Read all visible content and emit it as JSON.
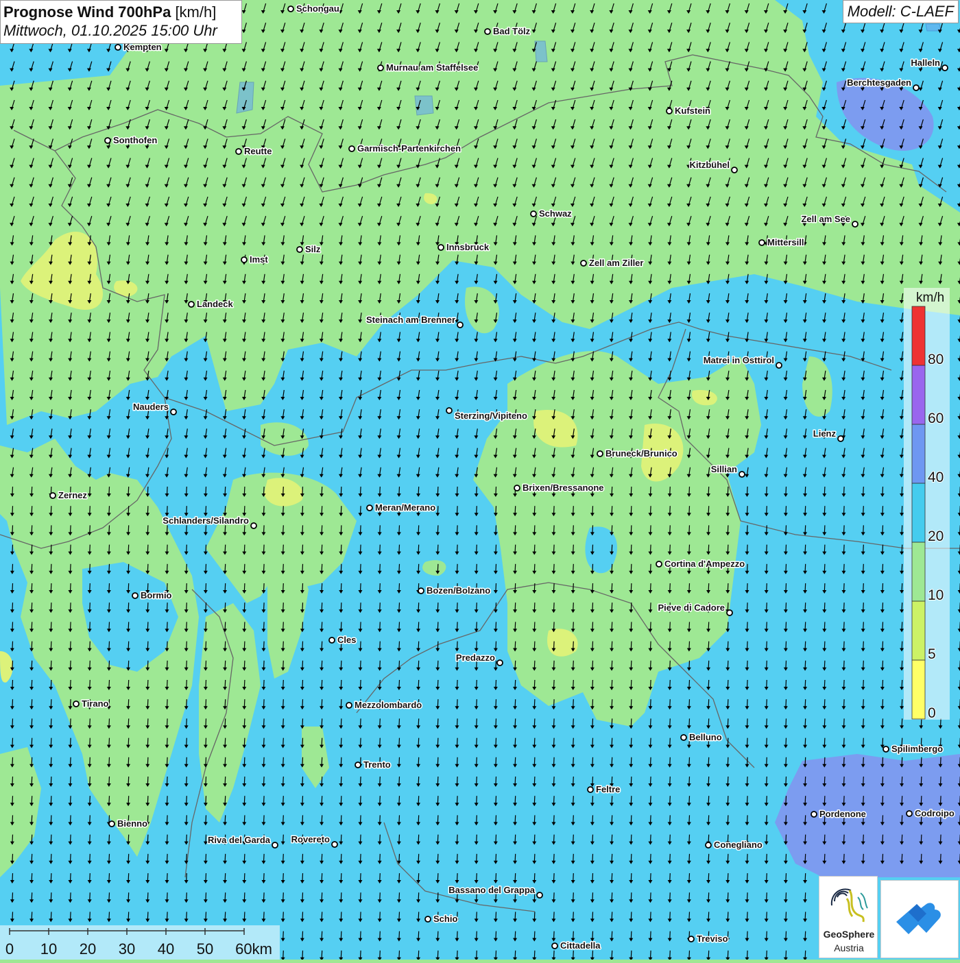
{
  "header": {
    "title_bold": "Prognose Wind 700hPa",
    "title_unit": "[km/h]",
    "subtitle": "Mittwoch, 01.10.2025 15:00 Uhr",
    "model": "Modell: C-LAEF"
  },
  "legend": {
    "unit": "km/h",
    "items": [
      {
        "label": "0",
        "color": "#ffff66"
      },
      {
        "label": "5",
        "color": "#ccf266"
      },
      {
        "label": "10",
        "color": "#9ee894"
      },
      {
        "label": "20",
        "color": "#44ccee"
      },
      {
        "label": "40",
        "color": "#6e97f2"
      },
      {
        "label": "60",
        "color": "#9966ee"
      },
      {
        "label": "80",
        "color": "#ee3333"
      }
    ]
  },
  "scale_bar": {
    "ticks": [
      "0",
      "10",
      "20",
      "30",
      "40",
      "50",
      "60km"
    ]
  },
  "logos": {
    "geosphere_line1": "GeoSphere",
    "geosphere_line2": "Austria"
  },
  "colors": {
    "land_light": "#9ee894",
    "wind_blue": "#55cff2",
    "wind_purple": "#7c9cf0",
    "calm_yellow": "#dcf27a",
    "border_line": "#555555",
    "arrow": "#000000"
  },
  "wind_direction": "north-to-south (arrows pointing down, slightly southwest in north)",
  "places": [
    {
      "name": "Schongau"
    },
    {
      "name": "Bad Tölz"
    },
    {
      "name": "Kempten"
    },
    {
      "name": "Murnau am Staffelsee"
    },
    {
      "name": "Halleln"
    },
    {
      "name": "Berchtesgaden"
    },
    {
      "name": "Kufstein"
    },
    {
      "name": "Sonthofen"
    },
    {
      "name": "Reutte"
    },
    {
      "name": "Garmisch-Partenkirchen"
    },
    {
      "name": "Kitzbühel"
    },
    {
      "name": "Schwaz"
    },
    {
      "name": "Zell am See"
    },
    {
      "name": "Mittersill"
    },
    {
      "name": "Silz"
    },
    {
      "name": "Innsbruck"
    },
    {
      "name": "Imst"
    },
    {
      "name": "Zell am Ziller"
    },
    {
      "name": "Landeck"
    },
    {
      "name": "Steinach am Brenner"
    },
    {
      "name": "Matrei in Osttirol"
    },
    {
      "name": "Nauders"
    },
    {
      "name": "Sterzing/Vipiteno"
    },
    {
      "name": "Lienz"
    },
    {
      "name": "Bruneck/Brunico"
    },
    {
      "name": "Sillian"
    },
    {
      "name": "Zernez"
    },
    {
      "name": "Brixen/Bressanone"
    },
    {
      "name": "Meran/Merano"
    },
    {
      "name": "Schlanders/Silandro"
    },
    {
      "name": "Cortina d'Ampezzo"
    },
    {
      "name": "Bozen/Bolzano"
    },
    {
      "name": "Bormio"
    },
    {
      "name": "Pieve di Cadore"
    },
    {
      "name": "Cles"
    },
    {
      "name": "Predazzo"
    },
    {
      "name": "Tirano"
    },
    {
      "name": "Mezzolombardo"
    },
    {
      "name": "Belluno"
    },
    {
      "name": "Spilimbergo"
    },
    {
      "name": "Trento"
    },
    {
      "name": "Feltre"
    },
    {
      "name": "Bienno"
    },
    {
      "name": "Pordenone"
    },
    {
      "name": "Codroipo"
    },
    {
      "name": "Riva del Garda"
    },
    {
      "name": "Rovereto"
    },
    {
      "name": "Conegliano"
    },
    {
      "name": "Bassano del Grappa"
    },
    {
      "name": "Schio"
    },
    {
      "name": "Treviso"
    },
    {
      "name": "Cittadella"
    }
  ]
}
